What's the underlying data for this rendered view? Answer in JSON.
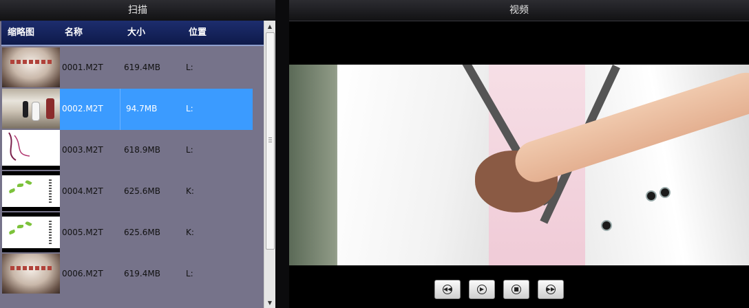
{
  "scan_panel": {
    "title": "扫描",
    "columns": {
      "thumbnail": "缩略图",
      "name": "名称",
      "size": "大小",
      "location": "位置"
    },
    "rows": [
      {
        "name": "0001.M2T",
        "size": "619.4MB",
        "location": "L:",
        "thumbnail": "sepia-title-card",
        "selected": false
      },
      {
        "name": "0002.M2T",
        "size": "94.7MB",
        "location": "L:",
        "thumbnail": "wedding-crowd",
        "selected": true
      },
      {
        "name": "0003.M2T",
        "size": "618.9MB",
        "location": "L:",
        "thumbnail": "white-vine",
        "selected": false
      },
      {
        "name": "0004.M2T",
        "size": "625.6MB",
        "location": "K:",
        "thumbnail": "green-leaves",
        "selected": false
      },
      {
        "name": "0005.M2T",
        "size": "625.6MB",
        "location": "K:",
        "thumbnail": "green-leaves",
        "selected": false
      },
      {
        "name": "0006.M2T",
        "size": "619.4MB",
        "location": "L:",
        "thumbnail": "sepia-title-card",
        "selected": false
      }
    ],
    "selection_color": "#3b9bff"
  },
  "video_panel": {
    "title": "视频",
    "controls": [
      {
        "icon": "rewind-icon"
      },
      {
        "icon": "play-icon"
      },
      {
        "icon": "stop-icon"
      },
      {
        "icon": "fast-forward-icon"
      }
    ]
  },
  "colors": {
    "header_bar": "#1d2d6e",
    "list_background": "#76738a",
    "window_background": "#0b0b0d"
  }
}
